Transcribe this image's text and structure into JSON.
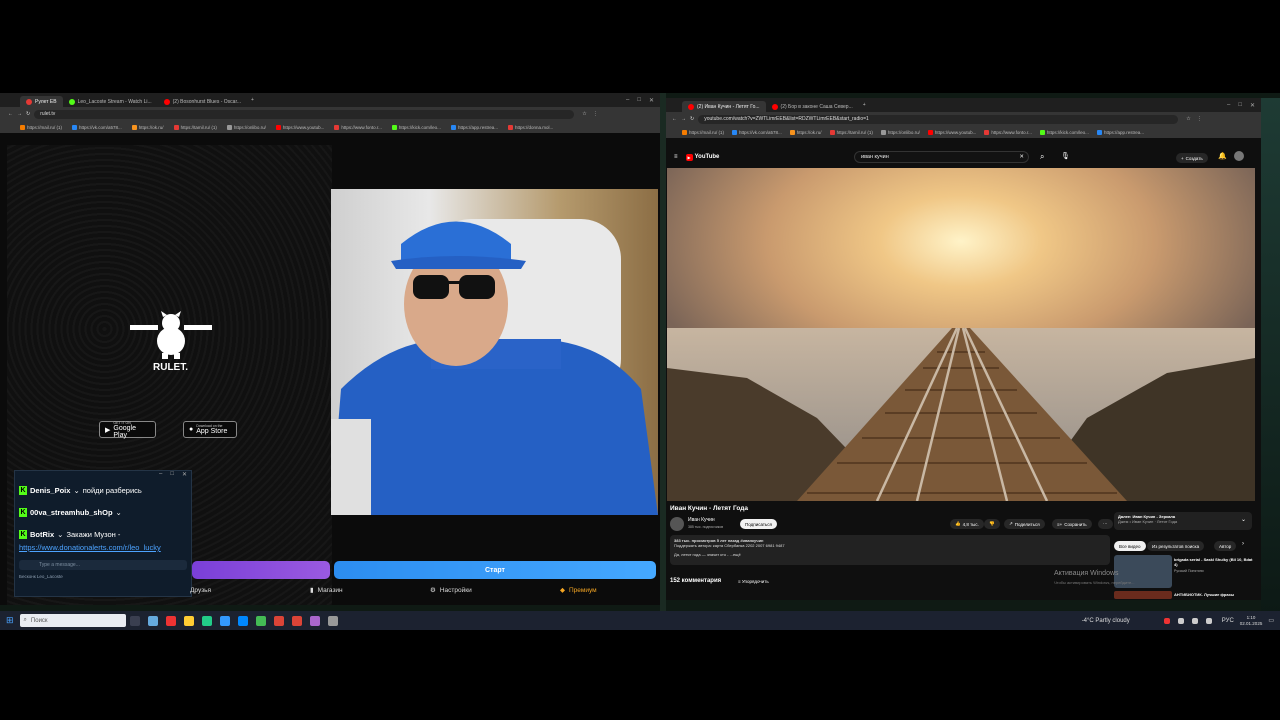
{
  "left_browser": {
    "tabs": [
      {
        "label": "Рулет ЕВ",
        "color": "#e53935",
        "active": true
      },
      {
        "label": "Leo_Lacoste Stream - Watch Li...",
        "color": "#53fc18",
        "active": false
      },
      {
        "label": "(2) Bosonhurst Blues - Oscar...",
        "color": "#ff0000",
        "active": false
      }
    ],
    "url": "rulet.tv",
    "bookmarks": [
      "https://mail.ru/ (1)",
      "https://vk.com/a578...",
      "https://ok.ru/",
      "https://tamil.ru/ (1)",
      "https://onlibo.ru/",
      "https://www.youtub...",
      "https://www.fonto.r...",
      "https://kick.com/leo...",
      "https://app.restrea...",
      "https://donna.mol..."
    ]
  },
  "rulet": {
    "logo_text": "RULET.",
    "google_play_small": "GET IT ON",
    "google_play": "Google Play",
    "app_store_small": "Download on the",
    "app_store": "App Store",
    "start_button": "Старт",
    "nav": [
      "Друзья",
      "Магазин",
      "Настройки",
      "Премиум"
    ]
  },
  "chat": {
    "messages": [
      {
        "user": "Denis_Poix",
        "text": "пойди разберись"
      },
      {
        "user": "00va_streamhub_shOp",
        "text": ""
      },
      {
        "user": "BotRix",
        "text": "Закажи Музон -"
      }
    ],
    "link": "https://www.donationalerts.com/r/leo_lucky",
    "input_placeholder": "Type a message...",
    "footer_user": "Бесконк Leo_Lacoste"
  },
  "right_browser": {
    "tabs": [
      {
        "label": "(2) Иван Кучин - Летят Го...",
        "color": "#ff0000",
        "active": true
      },
      {
        "label": "(2) Бор в законе Саша Север...",
        "color": "#ff0000",
        "active": false
      }
    ],
    "url": "youtube.com/watch?v=ZWTLimrEEB&list=RDZWTLimrEEB&start_radio=1",
    "bookmarks": [
      "https://mail.ru/ (1)",
      "https://vk.com/a578...",
      "https://ok.ru/",
      "https://tamil.ru/ (1)",
      "https://onlibo.ru/",
      "https://www.youtub...",
      "https://www.fonto.r...",
      "https://kick.com/leo...",
      "https://app.restrea..."
    ]
  },
  "youtube": {
    "logo": "YouTube",
    "search_query": "иван кучин",
    "create_label": "Создать",
    "video_title": "Иван Кучин - Летят Года",
    "channel": "Иван Кучин",
    "subscribers": "385 тыс. подписчиков",
    "subscribe": "Подписаться",
    "likes": "4,8 тыс.",
    "share": "Поделиться",
    "save": "Сохранить",
    "views_line": "383 тыс. просмотров  5 лет назад  #иванкучин",
    "description": "Поддержать автора: карта Сбербанка 2202 2007 6981 9487",
    "lyric": "Да, летят года — значит кто - ...ещё",
    "comments": "152 комментария",
    "sort": "Упорядочить",
    "next_label": "Далее: Иван Кучин - Зеркала",
    "next_sub": "Джем • Иван Кучин · Летят Года",
    "chips": [
      "Все видео",
      "Из результатов поиска",
      "Автор"
    ],
    "rec_title": "brigada serial - Saskl Shulky (Bil 10, Bdat 4)",
    "rec_sub": "Русский Понятяни",
    "rec2": "АНТИБИОТИК. Лучшие фразы",
    "activate": "Активация Windows",
    "activate_sub": "Чтобы активировать Windows, перейдите..."
  },
  "taskbar": {
    "search_placeholder": "Поиск",
    "weather": "-4°C  Partly cloudy",
    "lang": "РУС",
    "time": "1:10",
    "date": "02.01.2025"
  }
}
